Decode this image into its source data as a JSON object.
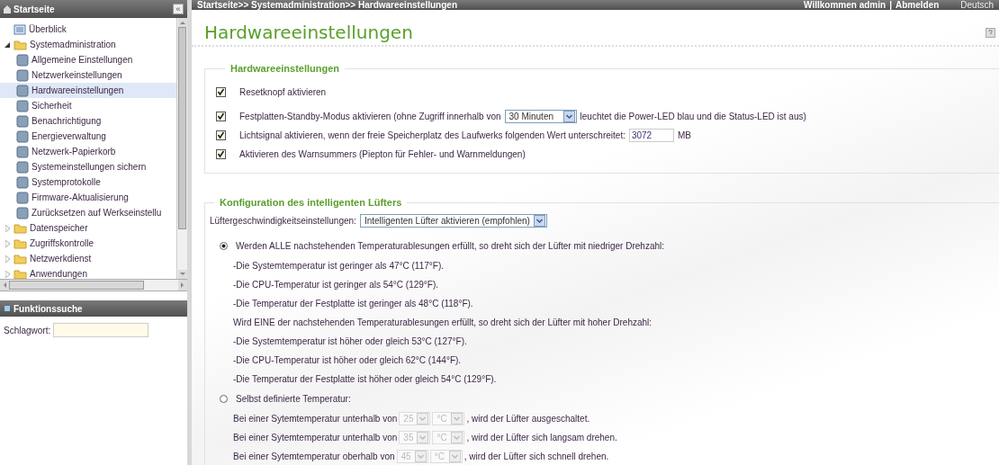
{
  "sidebar": {
    "title": "Startseite",
    "collapse_button": "«",
    "tree": [
      {
        "label": "Überblick",
        "kind": "page",
        "selected": false
      },
      {
        "label": "Systemadministration",
        "kind": "folder",
        "expanded": true,
        "selected": false,
        "children": [
          {
            "label": "Allgemeine Einstellungen",
            "selected": false
          },
          {
            "label": "Netzwerkeinstellungen",
            "selected": false
          },
          {
            "label": "Hardwareeinstellungen",
            "selected": true
          },
          {
            "label": "Sicherheit",
            "selected": false
          },
          {
            "label": "Benachrichtigung",
            "selected": false
          },
          {
            "label": "Energieverwaltung",
            "selected": false
          },
          {
            "label": "Netzwerk-Papierkorb",
            "selected": false
          },
          {
            "label": "Systemeinstellungen sichern",
            "selected": false
          },
          {
            "label": "Systemprotokolle",
            "selected": false
          },
          {
            "label": "Firmware-Aktualisierung",
            "selected": false
          },
          {
            "label": "Zurücksetzen auf Werkseinstellu",
            "selected": false
          }
        ]
      },
      {
        "label": "Datenspeicher",
        "kind": "folder",
        "expanded": false,
        "selected": false
      },
      {
        "label": "Zugriffskontrolle",
        "kind": "folder",
        "expanded": false,
        "selected": false
      },
      {
        "label": "Netzwerkdienst",
        "kind": "folder",
        "expanded": false,
        "selected": false
      },
      {
        "label": "Anwendungen",
        "kind": "folder",
        "expanded": false,
        "selected": false
      }
    ],
    "search": {
      "title": "Funktionssuche",
      "label": "Schlagwort:"
    }
  },
  "topbar": {
    "breadcrumb": "Startseite>> Systemadministration>> Hardwareeinstellungen",
    "welcome": "Willkommen admin",
    "separator": "|",
    "logout": "Abmelden",
    "language": "Deutsch"
  },
  "page_title": "Hardwareeinstellungen",
  "hardware": {
    "legend": "Hardwareeinstellungen",
    "options": [
      {
        "kind": "plain",
        "label": "Resetknopf aktivieren",
        "checked": true
      },
      {
        "kind": "select",
        "label": "Festplatten-Standby-Modus aktivieren (ohne Zugriff innerhalb von",
        "value": "30 Minuten",
        "label_after": "leuchtet die Power-LED blau und die Status-LED ist aus)",
        "checked": true
      },
      {
        "kind": "input",
        "label": "Lichtsignal aktivieren, wenn der freie Speicherplatz des Laufwerks folgenden Wert unterschreitet:",
        "value": "3072",
        "label_after": "MB",
        "checked": true
      },
      {
        "kind": "plain",
        "label": "Aktivieren des Warnsummers (Piepton für Fehler- und Warnmeldungen)",
        "checked": true
      }
    ]
  },
  "fan": {
    "legend": "Konfiguration des intelligenten Lüfters",
    "speed_label": "Lüftergeschwindigkeitseinstellungen:",
    "speed_value": "Intelligenten Lüfter aktivieren (empfohlen)",
    "modes": [
      {
        "kind": "smart",
        "label": "Werden ALLE nachstehenden Temperaturablesungen erfüllt, so dreht sich der Lüfter mit niedriger Drehzahl:",
        "selected": true,
        "lines": [
          "-Die Systemtemperatur ist geringer als 47°C (117°F).",
          "-Die CPU-Temperatur ist geringer als 54°C (129°F).",
          "-Die Temperatur der Festplatte ist geringer als 48°C (118°F).",
          "Wird EINE der nachstehenden Temperaturablesungen erfüllt, so dreht sich der Lüfter mit hoher Drehzahl:",
          "-Die Systemtemperatur ist höher oder gleich 53°C (127°F).",
          "-Die CPU-Temperatur ist höher oder gleich 62°C (144°F).",
          "-Die Temperatur der Festplatte ist höher oder gleich 54°C (129°F)."
        ]
      },
      {
        "kind": "custom",
        "label": "Selbst definierte Temperatur:",
        "selected": false,
        "rows": [
          {
            "prefix": "Bei einer Sytemtemperatur unterhalb von",
            "value": "25",
            "unit": "°C",
            "suffix": ", wird der Lüfter ausgeschaltet.",
            "disabled": true
          },
          {
            "prefix": "Bei einer Sytemtemperatur unterhalb von",
            "value": "35",
            "unit": "°C",
            "suffix": ", wird der Lüfter sich langsam drehen.",
            "disabled": true
          },
          {
            "prefix": "Bei einer Sytemtemperatur oberhalb von",
            "value": "45",
            "unit": "°C",
            "suffix": ", wird der Lüfter sich schnell drehen.",
            "disabled": true
          }
        ]
      }
    ]
  }
}
